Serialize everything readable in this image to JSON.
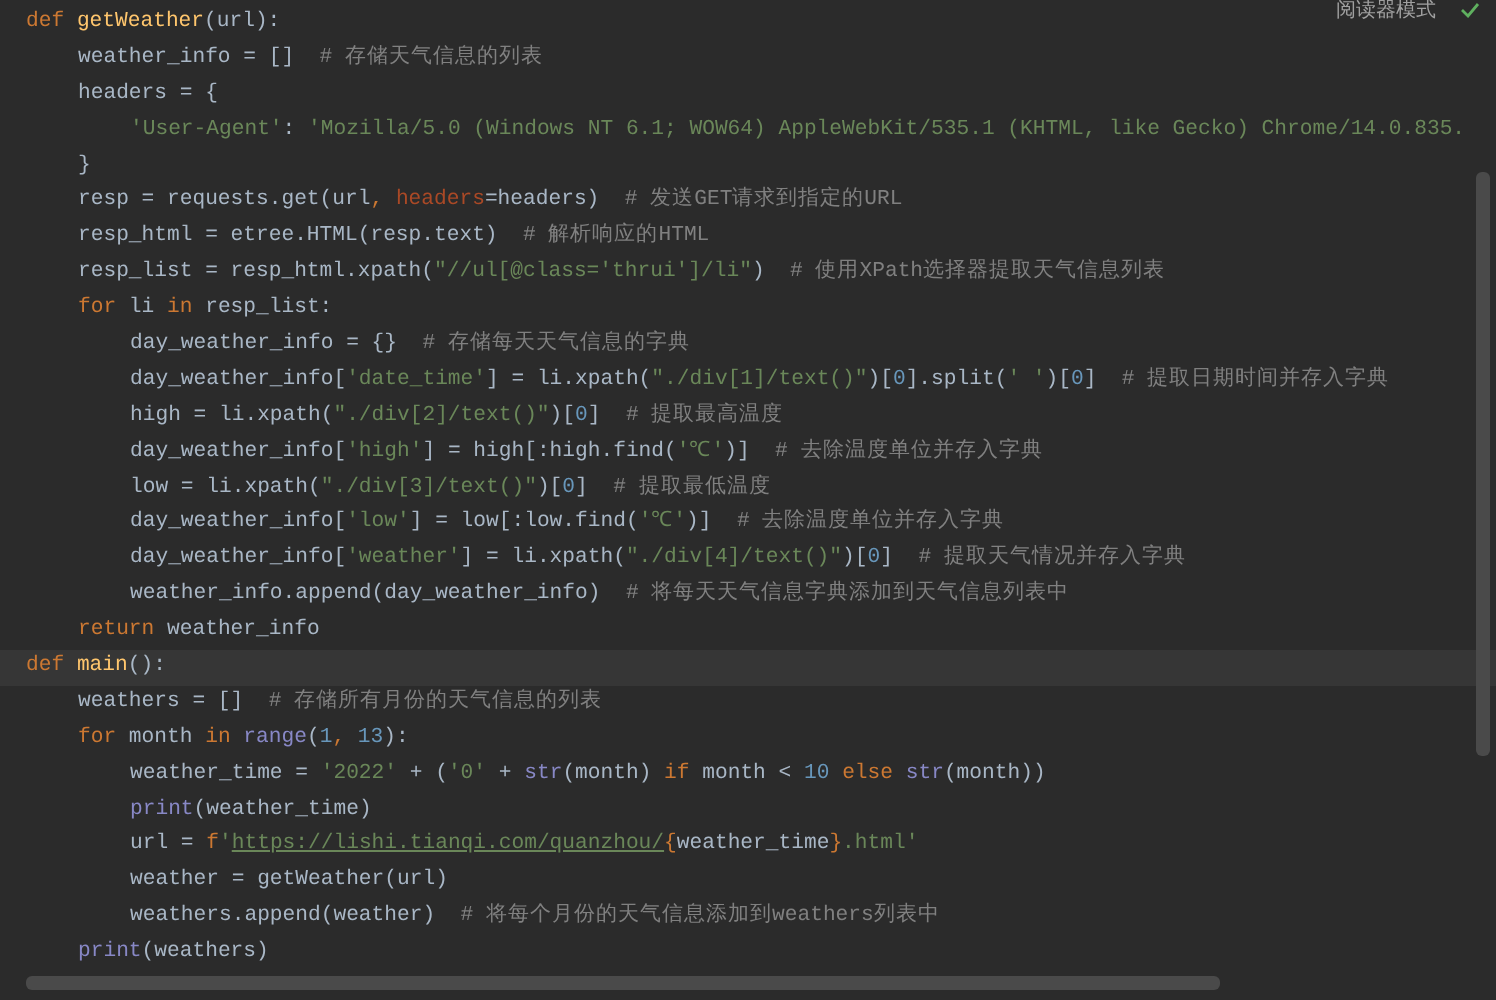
{
  "reader_mode": {
    "label": "阅读器模式"
  },
  "code_lines": [
    {
      "current": false,
      "tokens": [
        {
          "kind": "kw",
          "text": "def "
        },
        {
          "kind": "fn",
          "text": "getWeather"
        },
        {
          "kind": "plain",
          "text": "(url):"
        }
      ],
      "children": [
        {
          "current": false,
          "tokens": [
            {
              "kind": "plain",
              "text": "weather_info = []  "
            },
            {
              "kind": "comment",
              "text": "# 存储天气信息的列表"
            }
          ]
        },
        {
          "current": false,
          "tokens": [
            {
              "kind": "plain",
              "text": "headers = {"
            }
          ],
          "children": [
            {
              "current": false,
              "tokens": [
                {
                  "kind": "str",
                  "text": "'User-Agent'"
                },
                {
                  "kind": "plain",
                  "text": ": "
                },
                {
                  "kind": "str",
                  "text": "'Mozilla/5.0 (Windows NT 6.1; WOW64) AppleWebKit/535.1 (KHTML, like Gecko) Chrome/14.0.835."
                }
              ]
            }
          ]
        },
        {
          "current": false,
          "tokens": [
            {
              "kind": "plain",
              "text": "}"
            }
          ]
        },
        {
          "current": false,
          "tokens": [
            {
              "kind": "plain",
              "text": "resp = requests.get(url"
            },
            {
              "kind": "kw",
              "text": ", "
            },
            {
              "kind": "param",
              "text": "headers"
            },
            {
              "kind": "plain",
              "text": "=headers)  "
            },
            {
              "kind": "comment",
              "text": "# 发送GET请求到指定的URL"
            }
          ]
        },
        {
          "current": false,
          "tokens": [
            {
              "kind": "plain",
              "text": "resp_html = etree.HTML(resp.text)  "
            },
            {
              "kind": "comment",
              "text": "# 解析响应的HTML"
            }
          ]
        },
        {
          "current": false,
          "tokens": [
            {
              "kind": "plain",
              "text": "resp_list = resp_html.xpath("
            },
            {
              "kind": "str",
              "text": "\"//ul[@class='thrui']/li\""
            },
            {
              "kind": "plain",
              "text": ")  "
            },
            {
              "kind": "comment",
              "text": "# 使用XPath选择器提取天气信息列表"
            }
          ]
        },
        {
          "current": false,
          "tokens": [
            {
              "kind": "kw",
              "text": "for"
            },
            {
              "kind": "plain",
              "text": " li "
            },
            {
              "kind": "kw",
              "text": "in"
            },
            {
              "kind": "plain",
              "text": " resp_list:"
            }
          ],
          "children": [
            {
              "current": false,
              "tokens": [
                {
                  "kind": "plain",
                  "text": "day_weather_info = {}  "
                },
                {
                  "kind": "comment",
                  "text": "# 存储每天天气信息的字典"
                }
              ]
            },
            {
              "current": false,
              "tokens": [
                {
                  "kind": "plain",
                  "text": "day_weather_info["
                },
                {
                  "kind": "str",
                  "text": "'date_time'"
                },
                {
                  "kind": "plain",
                  "text": "] = li.xpath("
                },
                {
                  "kind": "str",
                  "text": "\"./div[1]/text()\""
                },
                {
                  "kind": "plain",
                  "text": ")["
                },
                {
                  "kind": "num",
                  "text": "0"
                },
                {
                  "kind": "plain",
                  "text": "].split("
                },
                {
                  "kind": "str",
                  "text": "' '"
                },
                {
                  "kind": "plain",
                  "text": ")["
                },
                {
                  "kind": "num",
                  "text": "0"
                },
                {
                  "kind": "plain",
                  "text": "]  "
                },
                {
                  "kind": "comment",
                  "text": "# 提取日期时间并存入字典"
                }
              ]
            },
            {
              "current": false,
              "tokens": [
                {
                  "kind": "plain",
                  "text": "high = li.xpath("
                },
                {
                  "kind": "str",
                  "text": "\"./div[2]/text()\""
                },
                {
                  "kind": "plain",
                  "text": ")["
                },
                {
                  "kind": "num",
                  "text": "0"
                },
                {
                  "kind": "plain",
                  "text": "]  "
                },
                {
                  "kind": "comment",
                  "text": "# 提取最高温度"
                }
              ]
            },
            {
              "current": false,
              "tokens": [
                {
                  "kind": "plain",
                  "text": "day_weather_info["
                },
                {
                  "kind": "str",
                  "text": "'high'"
                },
                {
                  "kind": "plain",
                  "text": "] = high[:high.find("
                },
                {
                  "kind": "str",
                  "text": "'℃'"
                },
                {
                  "kind": "plain",
                  "text": ")]  "
                },
                {
                  "kind": "comment",
                  "text": "# 去除温度单位并存入字典"
                }
              ]
            },
            {
              "current": false,
              "tokens": [
                {
                  "kind": "plain",
                  "text": "low = li.xpath("
                },
                {
                  "kind": "str",
                  "text": "\"./div[3]/text()\""
                },
                {
                  "kind": "plain",
                  "text": ")["
                },
                {
                  "kind": "num",
                  "text": "0"
                },
                {
                  "kind": "plain",
                  "text": "]  "
                },
                {
                  "kind": "comment",
                  "text": "# 提取最低温度"
                }
              ]
            },
            {
              "current": false,
              "tokens": [
                {
                  "kind": "plain",
                  "text": "day_weather_info["
                },
                {
                  "kind": "str",
                  "text": "'low'"
                },
                {
                  "kind": "plain",
                  "text": "] = low[:low.find("
                },
                {
                  "kind": "str",
                  "text": "'℃'"
                },
                {
                  "kind": "plain",
                  "text": ")]  "
                },
                {
                  "kind": "comment",
                  "text": "# 去除温度单位并存入字典"
                }
              ]
            },
            {
              "current": false,
              "tokens": [
                {
                  "kind": "plain",
                  "text": "day_weather_info["
                },
                {
                  "kind": "str",
                  "text": "'weather'"
                },
                {
                  "kind": "plain",
                  "text": "] = li.xpath("
                },
                {
                  "kind": "str",
                  "text": "\"./div[4]/text()\""
                },
                {
                  "kind": "plain",
                  "text": ")["
                },
                {
                  "kind": "num",
                  "text": "0"
                },
                {
                  "kind": "plain",
                  "text": "]  "
                },
                {
                  "kind": "comment",
                  "text": "# 提取天气情况并存入字典"
                }
              ]
            },
            {
              "current": false,
              "tokens": [
                {
                  "kind": "plain",
                  "text": "weather_info.append(day_weather_info)  "
                },
                {
                  "kind": "comment",
                  "text": "# 将每天天气信息字典添加到天气信息列表中"
                }
              ]
            }
          ]
        },
        {
          "current": false,
          "tokens": [
            {
              "kind": "kw",
              "text": "return"
            },
            {
              "kind": "plain",
              "text": " weather_info"
            }
          ]
        }
      ]
    },
    {
      "current": true,
      "tokens": [
        {
          "kind": "kw",
          "text": "def "
        },
        {
          "kind": "fn",
          "text": "main"
        },
        {
          "kind": "plain",
          "text": "():"
        }
      ],
      "children": [
        {
          "current": false,
          "tokens": [
            {
              "kind": "plain",
              "text": "weathers = []  "
            },
            {
              "kind": "comment",
              "text": "# 存储所有月份的天气信息的列表"
            }
          ]
        },
        {
          "current": false,
          "tokens": [
            {
              "kind": "kw",
              "text": "for"
            },
            {
              "kind": "plain",
              "text": " month "
            },
            {
              "kind": "kw",
              "text": "in "
            },
            {
              "kind": "builtin",
              "text": "range"
            },
            {
              "kind": "plain",
              "text": "("
            },
            {
              "kind": "num",
              "text": "1"
            },
            {
              "kind": "kw",
              "text": ", "
            },
            {
              "kind": "num",
              "text": "13"
            },
            {
              "kind": "plain",
              "text": "):"
            }
          ],
          "children": [
            {
              "current": false,
              "tokens": [
                {
                  "kind": "plain",
                  "text": "weather_time = "
                },
                {
                  "kind": "str",
                  "text": "'2022'"
                },
                {
                  "kind": "plain",
                  "text": " + ("
                },
                {
                  "kind": "str",
                  "text": "'0'"
                },
                {
                  "kind": "plain",
                  "text": " + "
                },
                {
                  "kind": "builtin",
                  "text": "str"
                },
                {
                  "kind": "plain",
                  "text": "(month) "
                },
                {
                  "kind": "kw",
                  "text": "if"
                },
                {
                  "kind": "plain",
                  "text": " month < "
                },
                {
                  "kind": "num",
                  "text": "10 "
                },
                {
                  "kind": "kw",
                  "text": "else "
                },
                {
                  "kind": "builtin",
                  "text": "str"
                },
                {
                  "kind": "plain",
                  "text": "(month))"
                }
              ]
            },
            {
              "current": false,
              "tokens": [
                {
                  "kind": "builtin",
                  "text": "print"
                },
                {
                  "kind": "plain",
                  "text": "(weather_time)"
                }
              ]
            },
            {
              "current": false,
              "tokens": [
                {
                  "kind": "plain",
                  "text": "url = "
                },
                {
                  "kind": "kw",
                  "text": "f"
                },
                {
                  "kind": "str",
                  "text": "'"
                },
                {
                  "kind": "link",
                  "text": "https://lishi.tianqi.com/quanzhou/"
                },
                {
                  "kind": "brace",
                  "text": "{"
                },
                {
                  "kind": "plain",
                  "text": "weather_time"
                },
                {
                  "kind": "brace",
                  "text": "}"
                },
                {
                  "kind": "str",
                  "text": ".html'"
                }
              ]
            },
            {
              "current": false,
              "tokens": [
                {
                  "kind": "plain",
                  "text": "weather = getWeather(url)"
                }
              ]
            },
            {
              "current": false,
              "tokens": [
                {
                  "kind": "plain",
                  "text": "weathers.append(weather)  "
                },
                {
                  "kind": "comment",
                  "text": "# 将每个月份的天气信息添加到weathers列表中"
                }
              ]
            }
          ]
        },
        {
          "current": false,
          "tokens": [
            {
              "kind": "builtin",
              "text": "print"
            },
            {
              "kind": "plain",
              "text": "(weathers)"
            }
          ]
        }
      ]
    }
  ]
}
